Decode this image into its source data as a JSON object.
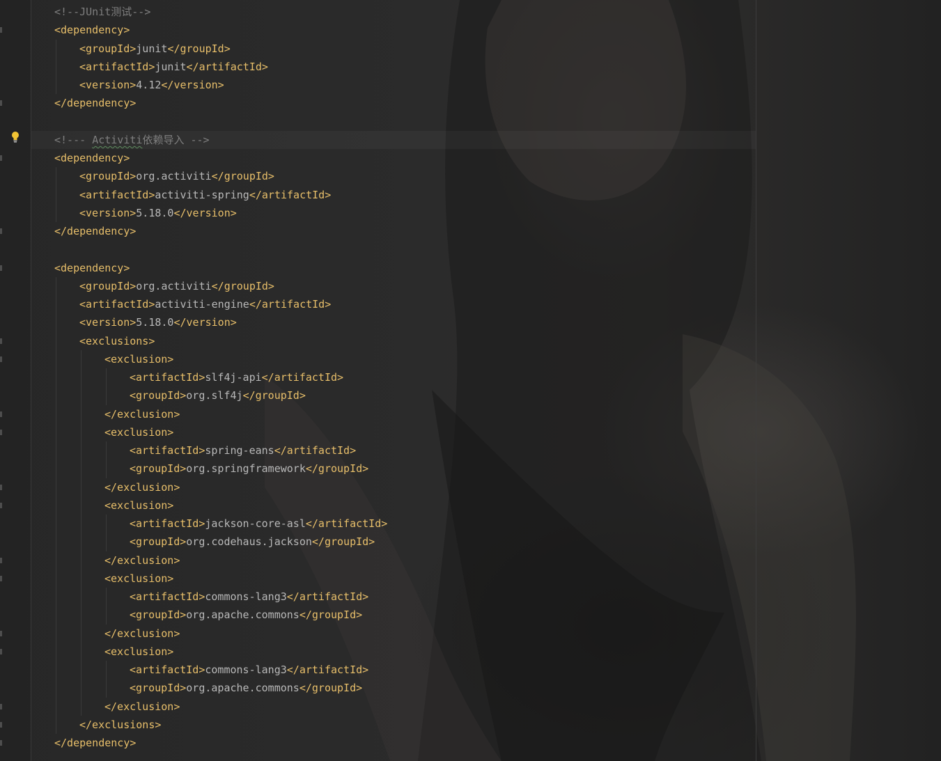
{
  "editor": {
    "language": "xml",
    "colors": {
      "tag": "#e8bf6a",
      "text": "#b9b9b9",
      "comment": "#7f7f7f",
      "background": "#2b2b2b",
      "gutter_icon": "#f2c434"
    },
    "gutter": {
      "intention_icon": "lightbulb-icon"
    },
    "lines": [
      {
        "indent": 1,
        "parts": [
          {
            "t": "cmt",
            "v": "<!--JUnit测试-->"
          }
        ]
      },
      {
        "indent": 1,
        "parts": [
          {
            "t": "tag",
            "v": "<dependency>"
          }
        ]
      },
      {
        "indent": 2,
        "parts": [
          {
            "t": "tag",
            "v": "<groupId>"
          },
          {
            "t": "val",
            "v": "junit"
          },
          {
            "t": "tag",
            "v": "</groupId>"
          }
        ]
      },
      {
        "indent": 2,
        "parts": [
          {
            "t": "tag",
            "v": "<artifactId>"
          },
          {
            "t": "val",
            "v": "junit"
          },
          {
            "t": "tag",
            "v": "</artifactId>"
          }
        ]
      },
      {
        "indent": 2,
        "parts": [
          {
            "t": "tag",
            "v": "<version>"
          },
          {
            "t": "val",
            "v": "4.12"
          },
          {
            "t": "tag",
            "v": "</version>"
          }
        ]
      },
      {
        "indent": 1,
        "parts": [
          {
            "t": "tag",
            "v": "</dependency>"
          }
        ]
      },
      {
        "indent": 0,
        "parts": []
      },
      {
        "indent": 1,
        "parts": [
          {
            "t": "cmt",
            "v": "<!--- "
          },
          {
            "t": "cmt",
            "v": "Activiti",
            "squiggle": true
          },
          {
            "t": "cmt",
            "v": "依赖导入 -->"
          }
        ]
      },
      {
        "indent": 1,
        "parts": [
          {
            "t": "tag",
            "v": "<dependency>"
          }
        ]
      },
      {
        "indent": 2,
        "parts": [
          {
            "t": "tag",
            "v": "<groupId>"
          },
          {
            "t": "val",
            "v": "org.activiti"
          },
          {
            "t": "tag",
            "v": "</groupId>"
          }
        ]
      },
      {
        "indent": 2,
        "parts": [
          {
            "t": "tag",
            "v": "<artifactId>"
          },
          {
            "t": "val",
            "v": "activiti-spring"
          },
          {
            "t": "tag",
            "v": "</artifactId>"
          }
        ]
      },
      {
        "indent": 2,
        "parts": [
          {
            "t": "tag",
            "v": "<version>"
          },
          {
            "t": "val",
            "v": "5.18.0"
          },
          {
            "t": "tag",
            "v": "</version>"
          }
        ]
      },
      {
        "indent": 1,
        "parts": [
          {
            "t": "tag",
            "v": "</dependency>"
          }
        ]
      },
      {
        "indent": 0,
        "parts": []
      },
      {
        "indent": 1,
        "parts": [
          {
            "t": "tag",
            "v": "<dependency>"
          }
        ]
      },
      {
        "indent": 2,
        "parts": [
          {
            "t": "tag",
            "v": "<groupId>"
          },
          {
            "t": "val",
            "v": "org.activiti"
          },
          {
            "t": "tag",
            "v": "</groupId>"
          }
        ]
      },
      {
        "indent": 2,
        "parts": [
          {
            "t": "tag",
            "v": "<artifactId>"
          },
          {
            "t": "val",
            "v": "activiti-engine"
          },
          {
            "t": "tag",
            "v": "</artifactId>"
          }
        ]
      },
      {
        "indent": 2,
        "parts": [
          {
            "t": "tag",
            "v": "<version>"
          },
          {
            "t": "val",
            "v": "5.18.0"
          },
          {
            "t": "tag",
            "v": "</version>"
          }
        ]
      },
      {
        "indent": 2,
        "parts": [
          {
            "t": "tag",
            "v": "<exclusions>"
          }
        ]
      },
      {
        "indent": 3,
        "parts": [
          {
            "t": "tag",
            "v": "<exclusion>"
          }
        ]
      },
      {
        "indent": 4,
        "parts": [
          {
            "t": "tag",
            "v": "<artifactId>"
          },
          {
            "t": "val",
            "v": "slf4j-api"
          },
          {
            "t": "tag",
            "v": "</artifactId>"
          }
        ]
      },
      {
        "indent": 4,
        "parts": [
          {
            "t": "tag",
            "v": "<groupId>"
          },
          {
            "t": "val",
            "v": "org.slf4j"
          },
          {
            "t": "tag",
            "v": "</groupId>"
          }
        ]
      },
      {
        "indent": 3,
        "parts": [
          {
            "t": "tag",
            "v": "</exclusion>"
          }
        ]
      },
      {
        "indent": 3,
        "parts": [
          {
            "t": "tag",
            "v": "<exclusion>"
          }
        ]
      },
      {
        "indent": 4,
        "parts": [
          {
            "t": "tag",
            "v": "<artifactId>"
          },
          {
            "t": "val",
            "v": "spring-eans"
          },
          {
            "t": "tag",
            "v": "</artifactId>"
          }
        ]
      },
      {
        "indent": 4,
        "parts": [
          {
            "t": "tag",
            "v": "<groupId>"
          },
          {
            "t": "val",
            "v": "org.springframework"
          },
          {
            "t": "tag",
            "v": "</groupId>"
          }
        ]
      },
      {
        "indent": 3,
        "parts": [
          {
            "t": "tag",
            "v": "</exclusion>"
          }
        ]
      },
      {
        "indent": 3,
        "parts": [
          {
            "t": "tag",
            "v": "<exclusion>"
          }
        ]
      },
      {
        "indent": 4,
        "parts": [
          {
            "t": "tag",
            "v": "<artifactId>"
          },
          {
            "t": "val",
            "v": "jackson-core-asl"
          },
          {
            "t": "tag",
            "v": "</artifactId>"
          }
        ]
      },
      {
        "indent": 4,
        "parts": [
          {
            "t": "tag",
            "v": "<groupId>"
          },
          {
            "t": "val",
            "v": "org.codehaus.jackson"
          },
          {
            "t": "tag",
            "v": "</groupId>"
          }
        ]
      },
      {
        "indent": 3,
        "parts": [
          {
            "t": "tag",
            "v": "</exclusion>"
          }
        ]
      },
      {
        "indent": 3,
        "parts": [
          {
            "t": "tag",
            "v": "<exclusion>"
          }
        ]
      },
      {
        "indent": 4,
        "parts": [
          {
            "t": "tag",
            "v": "<artifactId>"
          },
          {
            "t": "val",
            "v": "commons-lang3"
          },
          {
            "t": "tag",
            "v": "</artifactId>"
          }
        ]
      },
      {
        "indent": 4,
        "parts": [
          {
            "t": "tag",
            "v": "<groupId>"
          },
          {
            "t": "val",
            "v": "org.apache.commons"
          },
          {
            "t": "tag",
            "v": "</groupId>"
          }
        ]
      },
      {
        "indent": 3,
        "parts": [
          {
            "t": "tag",
            "v": "</exclusion>"
          }
        ]
      },
      {
        "indent": 3,
        "parts": [
          {
            "t": "tag",
            "v": "<exclusion>"
          }
        ]
      },
      {
        "indent": 4,
        "parts": [
          {
            "t": "tag",
            "v": "<artifactId>"
          },
          {
            "t": "val",
            "v": "commons-lang3"
          },
          {
            "t": "tag",
            "v": "</artifactId>"
          }
        ]
      },
      {
        "indent": 4,
        "parts": [
          {
            "t": "tag",
            "v": "<groupId>"
          },
          {
            "t": "val",
            "v": "org.apache.commons"
          },
          {
            "t": "tag",
            "v": "</groupId>"
          }
        ]
      },
      {
        "indent": 3,
        "parts": [
          {
            "t": "tag",
            "v": "</exclusion>"
          }
        ]
      },
      {
        "indent": 2,
        "parts": [
          {
            "t": "tag",
            "v": "</exclusions>"
          }
        ]
      },
      {
        "indent": 1,
        "parts": [
          {
            "t": "tag",
            "v": "</dependency>"
          }
        ]
      }
    ]
  }
}
